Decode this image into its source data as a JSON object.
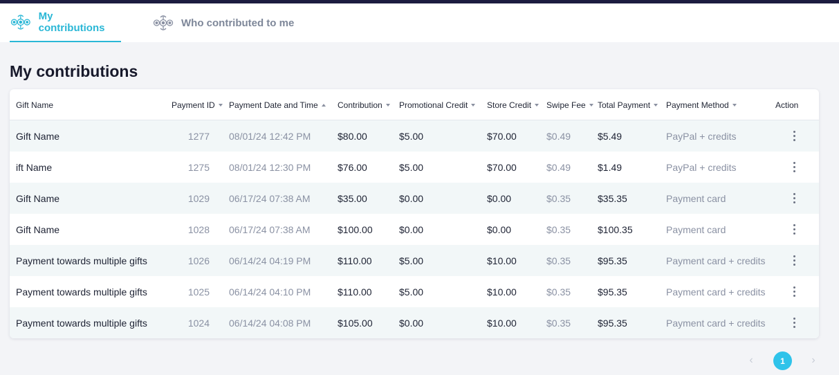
{
  "tabs": [
    {
      "label": "My contributions",
      "active": true,
      "icon": "gift-swirl-icon"
    },
    {
      "label": "Who contributed to me",
      "active": false,
      "icon": "gift-swirl-icon"
    }
  ],
  "page_title": "My contributions",
  "table": {
    "columns": [
      {
        "label": "Gift Name",
        "sortable": false
      },
      {
        "label": "Payment ID",
        "sortable": true,
        "sort": "down"
      },
      {
        "label": "Payment Date and Time",
        "sortable": true,
        "sort": "up"
      },
      {
        "label": "Contribution",
        "sortable": true,
        "sort": "down"
      },
      {
        "label": "Promotional Credit",
        "sortable": true,
        "sort": "down"
      },
      {
        "label": "Store Credit",
        "sortable": true,
        "sort": "down"
      },
      {
        "label": "Swipe Fee",
        "sortable": true,
        "sort": "down"
      },
      {
        "label": "Total Payment",
        "sortable": true,
        "sort": "down"
      },
      {
        "label": "Payment Method",
        "sortable": true,
        "sort": "down"
      },
      {
        "label": "Action",
        "sortable": false
      }
    ],
    "rows": [
      {
        "gift": "Gift Name",
        "id": "1277",
        "date": "08/01/24 12:42 PM",
        "contribution": "$80.00",
        "promo": "$5.00",
        "store": "$70.00",
        "fee": "$0.49",
        "total": "$5.49",
        "method": "PayPal + credits"
      },
      {
        "gift": "ift Name",
        "id": "1275",
        "date": "08/01/24 12:30 PM",
        "contribution": "$76.00",
        "promo": "$5.00",
        "store": "$70.00",
        "fee": "$0.49",
        "total": "$1.49",
        "method": "PayPal + credits"
      },
      {
        "gift": "Gift Name",
        "id": "1029",
        "date": "06/17/24 07:38 AM",
        "contribution": "$35.00",
        "promo": "$0.00",
        "store": "$0.00",
        "fee": "$0.35",
        "total": "$35.35",
        "method": "Payment card"
      },
      {
        "gift": "Gift Name",
        "id": "1028",
        "date": "06/17/24 07:38 AM",
        "contribution": "$100.00",
        "promo": "$0.00",
        "store": "$0.00",
        "fee": "$0.35",
        "total": "$100.35",
        "method": "Payment card"
      },
      {
        "gift": "Payment towards multiple gifts",
        "id": "1026",
        "date": "06/14/24 04:19 PM",
        "contribution": "$110.00",
        "promo": "$5.00",
        "store": "$10.00",
        "fee": "$0.35",
        "total": "$95.35",
        "method": "Payment card + credits"
      },
      {
        "gift": "Payment towards multiple gifts",
        "id": "1025",
        "date": "06/14/24 04:10 PM",
        "contribution": "$110.00",
        "promo": "$5.00",
        "store": "$10.00",
        "fee": "$0.35",
        "total": "$95.35",
        "method": "Payment card + credits"
      },
      {
        "gift": "Payment towards multiple gifts",
        "id": "1024",
        "date": "06/14/24 04:08 PM",
        "contribution": "$105.00",
        "promo": "$0.00",
        "store": "$10.00",
        "fee": "$0.35",
        "total": "$95.35",
        "method": "Payment card + credits"
      }
    ]
  },
  "pagination": {
    "prev": "‹",
    "current": "1",
    "next": "›"
  },
  "colors": {
    "accent": "#2ab7d6",
    "topbar": "#1c1c40",
    "page_bg": "#f3f4f7",
    "row_alt": "#f2f7f8",
    "pager_active": "#2fc3ea"
  }
}
